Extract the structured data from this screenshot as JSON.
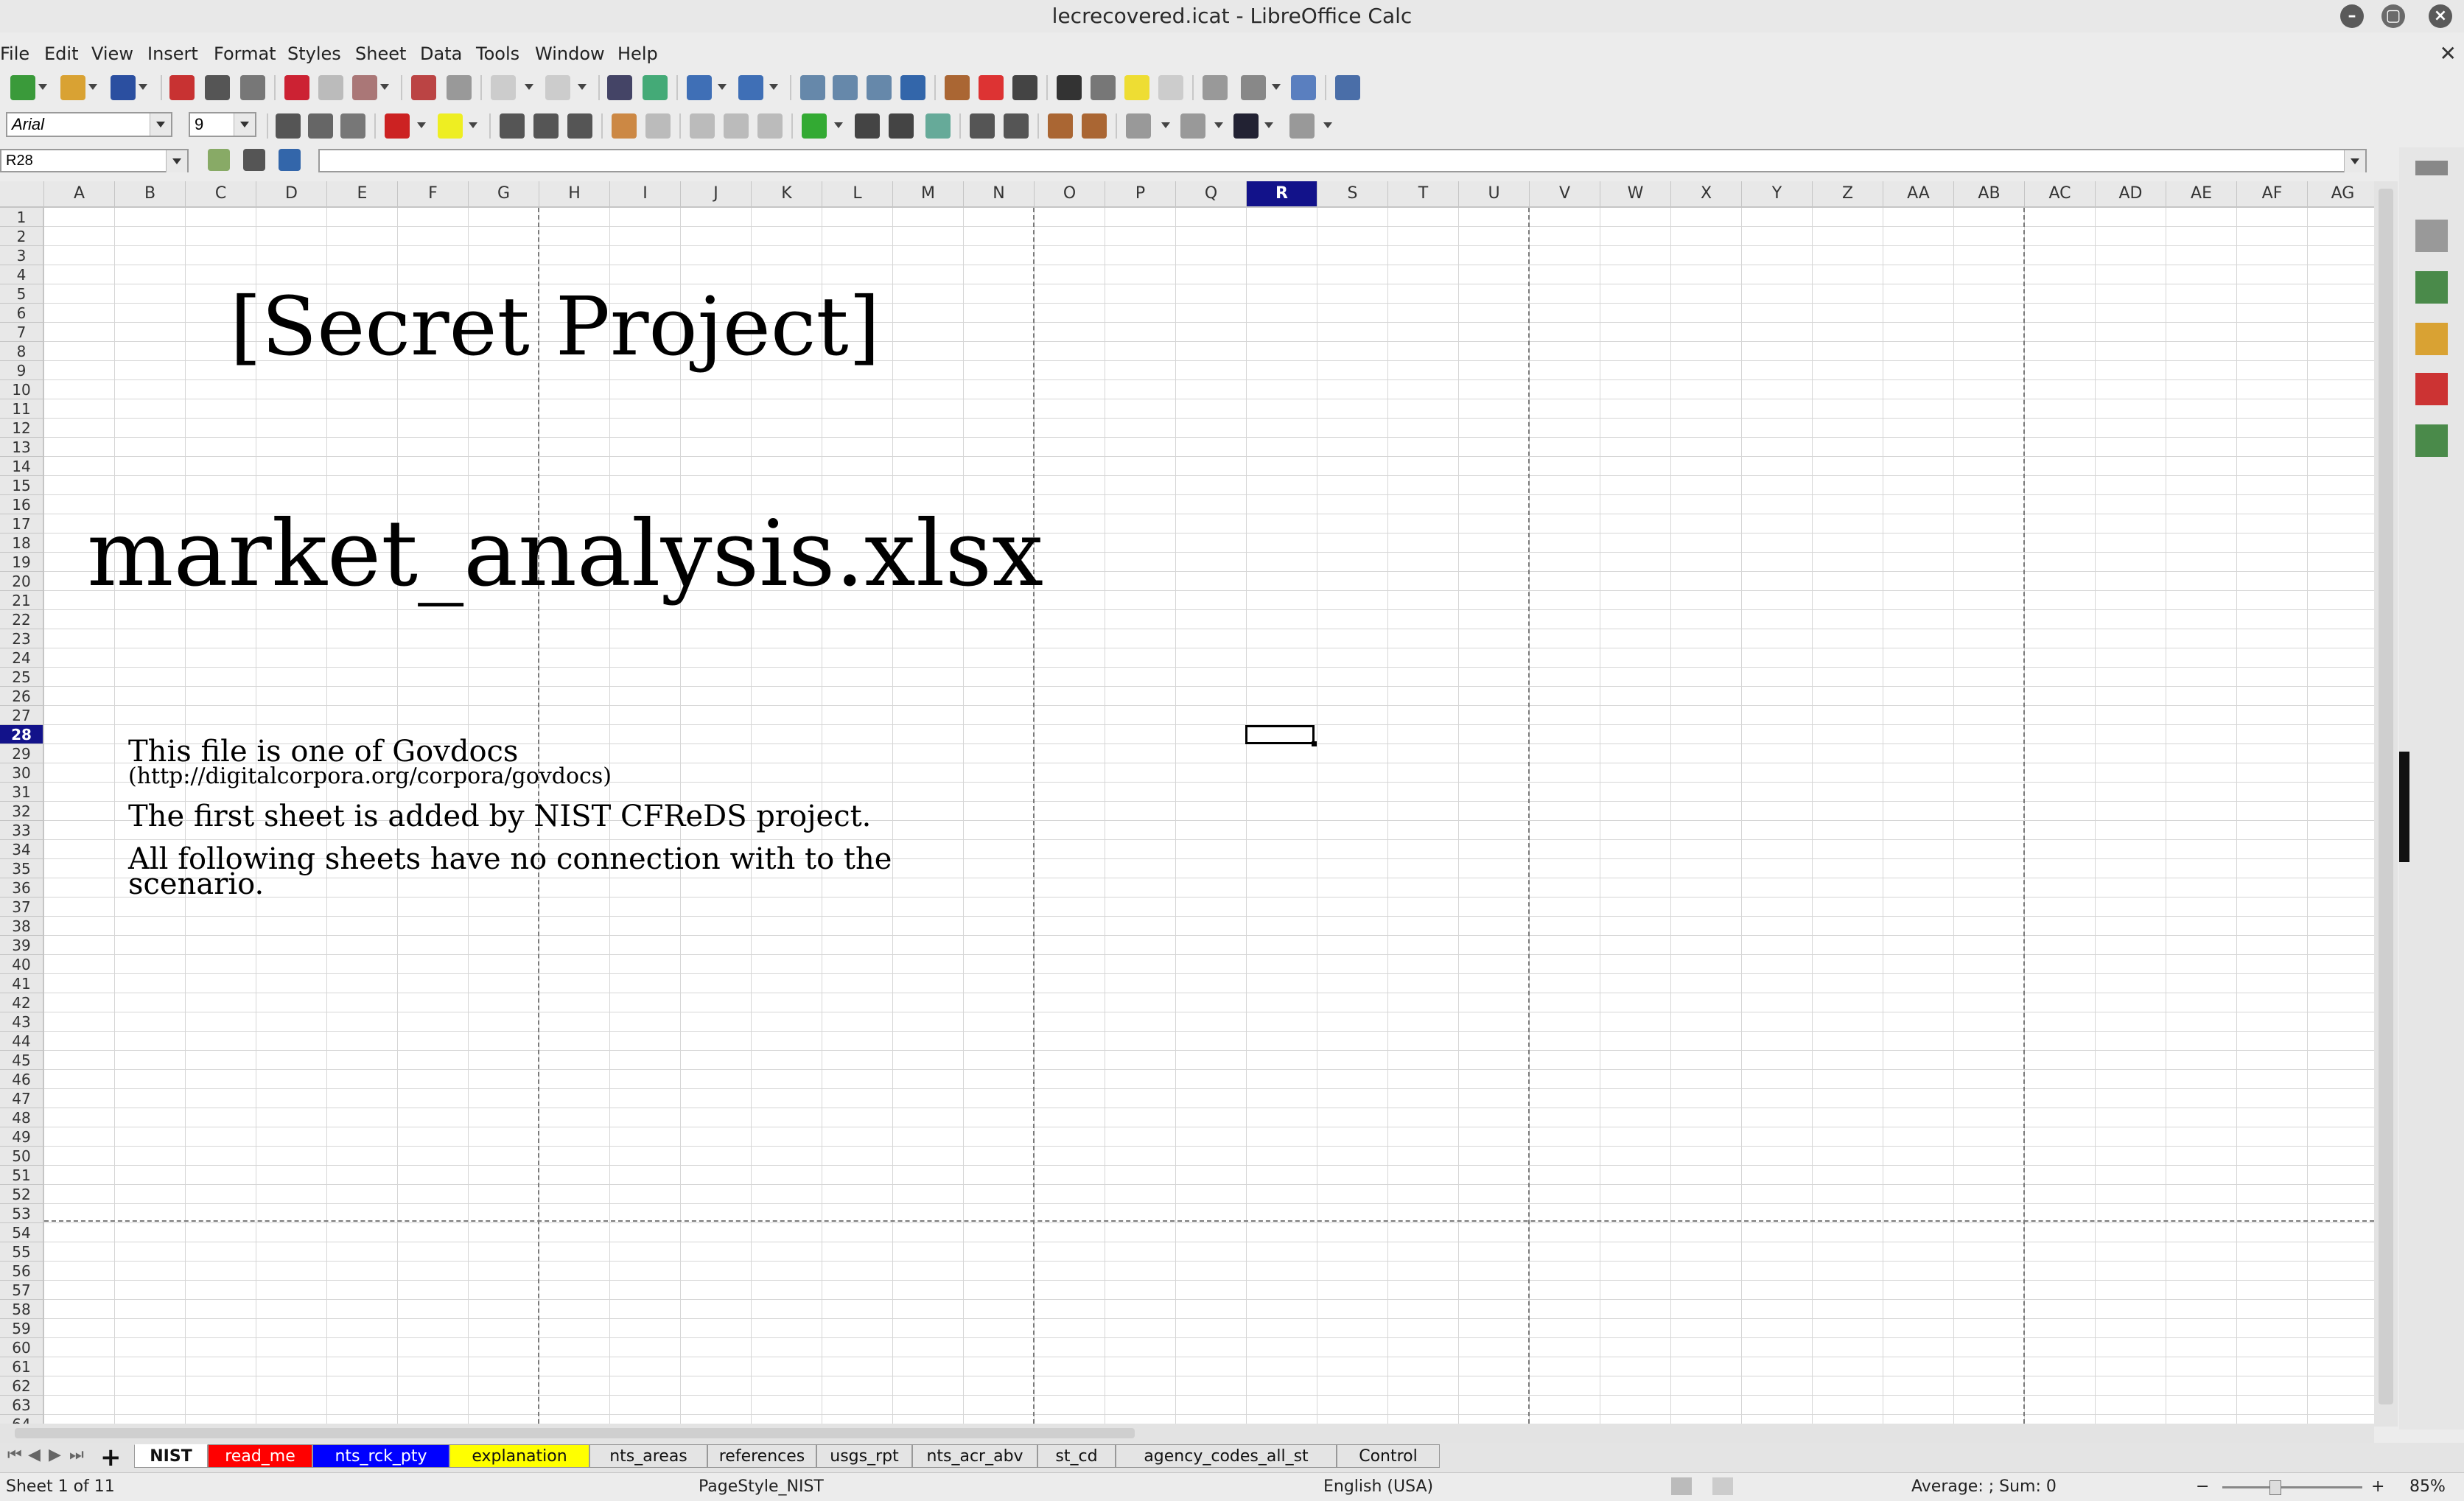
{
  "window": {
    "title": "lecrecovered.icat - LibreOffice Calc"
  },
  "menu": [
    "File",
    "Edit",
    "View",
    "Insert",
    "Format",
    "Styles",
    "Sheet",
    "Data",
    "Tools",
    "Window",
    "Help"
  ],
  "formatting": {
    "font_name": "Arial",
    "font_size": "9"
  },
  "formula_bar": {
    "name_box": "R28",
    "content": ""
  },
  "columns": [
    "A",
    "B",
    "C",
    "D",
    "E",
    "F",
    "G",
    "H",
    "I",
    "J",
    "K",
    "L",
    "M",
    "N",
    "O",
    "P",
    "Q",
    "R",
    "S",
    "T",
    "U",
    "V",
    "W",
    "X",
    "Y",
    "Z",
    "AA",
    "AB",
    "AC",
    "AD",
    "AE",
    "AF",
    "AG"
  ],
  "selected_column": "R",
  "selected_row": "28",
  "row_count": 64,
  "sheet": {
    "title": "[Secret Project]",
    "filename": "market_analysis.xlsx",
    "line1": "This file is one of Govdocs",
    "line2": "(http://digitalcorpora.org/corpora/govdocs)",
    "line3": "The first sheet is added by NIST CFReDS project.",
    "line4a": "All following sheets have no connection with to the",
    "line4b": "scenario."
  },
  "tabs": [
    {
      "label": "NIST",
      "bg": "#ffffff",
      "active": true
    },
    {
      "label": "read_me",
      "bg": "#ff0000"
    },
    {
      "label": "nts_rck_pty",
      "bg": "#0000ff"
    },
    {
      "label": "explanation",
      "bg": "#ffff00"
    },
    {
      "label": "nts_areas",
      "bg": "#e4e4e4"
    },
    {
      "label": "references",
      "bg": "#e4e4e4"
    },
    {
      "label": "usgs_rpt",
      "bg": "#e4e4e4"
    },
    {
      "label": "nts_acr_abv",
      "bg": "#e4e4e4"
    },
    {
      "label": "st_cd",
      "bg": "#e4e4e4"
    },
    {
      "label": "agency_codes_all_st",
      "bg": "#e4e4e4"
    },
    {
      "label": "Control",
      "bg": "#e4e4e4"
    }
  ],
  "status": {
    "sheet_info": "Sheet 1 of 11",
    "page_style": "PageStyle_NIST",
    "language": "English (USA)",
    "summary": "Average: ; Sum: 0",
    "zoom": "85%"
  },
  "icons": {
    "sidebar": [
      "properties-icon",
      "styles-icon",
      "gallery-icon",
      "navigator-icon",
      "functions-icon"
    ]
  }
}
